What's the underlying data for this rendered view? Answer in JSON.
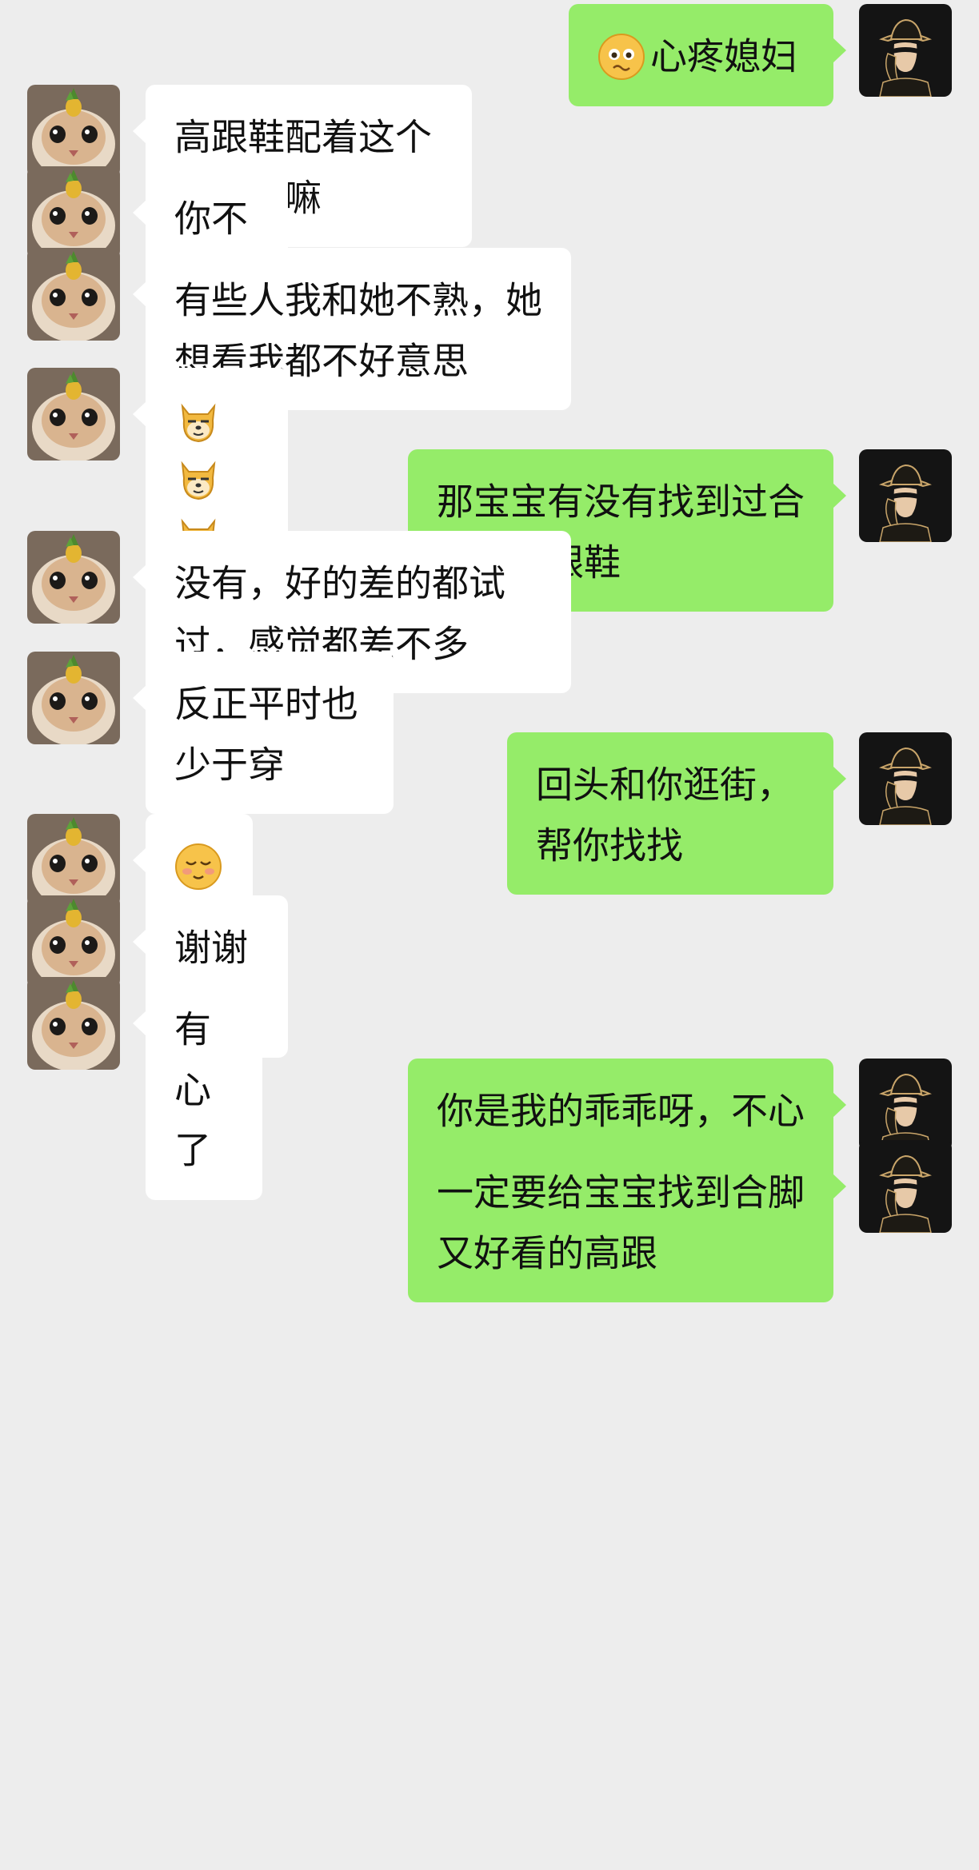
{
  "colors": {
    "background": "#ededed",
    "bubble_self": "#95ec69",
    "bubble_other": "#ffffff"
  },
  "avatars": {
    "self": "masked-man-in-hat-avatar",
    "other": "cat-with-pineapple-avatar"
  },
  "messages": [
    {
      "from": "self",
      "emoji": [
        "worried-face"
      ],
      "text": "心疼媳妇"
    },
    {
      "from": "other",
      "text": "高跟鞋配着这个好看了嘛"
    },
    {
      "from": "other",
      "text": "你不知道"
    },
    {
      "from": "other",
      "text": "有些人我和她不熟，她想看我都不好意思"
    },
    {
      "from": "other",
      "emoji": [
        "doge",
        "doge",
        "doge"
      ],
      "text": ""
    },
    {
      "from": "self",
      "text": "那宝宝有没有找到过合脚的高跟鞋"
    },
    {
      "from": "other",
      "text": "没有，好的差的都试过，感觉都差不多"
    },
    {
      "from": "other",
      "text": "反正平时也少于穿"
    },
    {
      "from": "self",
      "text": "回头和你逛街，帮你找找"
    },
    {
      "from": "other",
      "emoji": [
        "shy-smile",
        "shy-smile"
      ],
      "text": ""
    },
    {
      "from": "other",
      "text": "谢谢宝宝"
    },
    {
      "from": "other",
      "text": "有心了"
    },
    {
      "from": "self",
      "text": "你是我的乖乖呀，不心疼你心疼谁"
    },
    {
      "from": "self",
      "text": "一定要给宝宝找到合脚又好看的高跟"
    }
  ]
}
